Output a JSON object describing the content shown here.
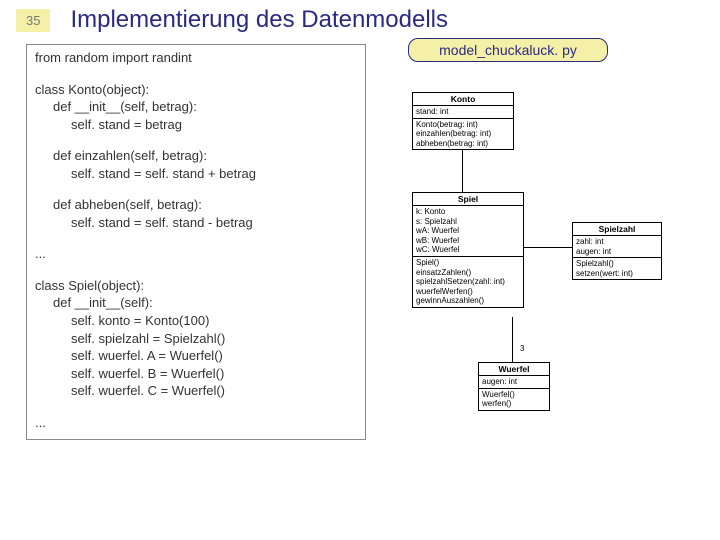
{
  "page_number": "35",
  "title": "Implementierung des Datenmodells",
  "filename": "model_chuckaluck. py",
  "code": {
    "l0": "from random import randint",
    "l1": "class Konto(object):",
    "l2": "def __init__(self, betrag):",
    "l3": "self. stand = betrag",
    "l4": "def einzahlen(self, betrag):",
    "l5": "self. stand = self. stand + betrag",
    "l6": "def abheben(self, betrag):",
    "l7": "self. stand = self. stand - betrag",
    "l8": "...",
    "l9": "class Spiel(object):",
    "l10": "def __init__(self):",
    "l11": "self. konto = Konto(100)",
    "l12": "self. spielzahl = Spielzahl()",
    "l13": "self. wuerfel. A = Wuerfel()",
    "l14": "self. wuerfel. B = Wuerfel()",
    "l15": "self. wuerfel. C = Wuerfel()",
    "l16": "..."
  },
  "uml": {
    "konto": {
      "title": "Konto",
      "attrs": [
        "stand: int"
      ],
      "ops": [
        "Konto(betrag: int)",
        "einzahlen(betrag: int)",
        "abheben(betrag: int)"
      ]
    },
    "spiel": {
      "title": "Spiel",
      "attrs": [
        "k: Konto",
        "s: Spielzahl",
        "wA: Wuerfel",
        "wB: Wuerfel",
        "wC: Wuerfel"
      ],
      "ops": [
        "Spiel()",
        "einsatzZahlen()",
        "spielzahlSetzen(zahl: int)",
        "wuerfelWerfen()",
        "gewinnAuszahlen()"
      ]
    },
    "spielzahl": {
      "title": "Spielzahl",
      "attrs": [
        "zahl: int",
        "augen: int"
      ],
      "ops": [
        "Spielzahl()",
        "setzen(wert: int)"
      ]
    },
    "wuerfel": {
      "title": "Wuerfel",
      "attrs": [
        "augen: int"
      ],
      "ops": [
        "Wuerfel()",
        "werfen()"
      ]
    },
    "mult3": "3"
  }
}
